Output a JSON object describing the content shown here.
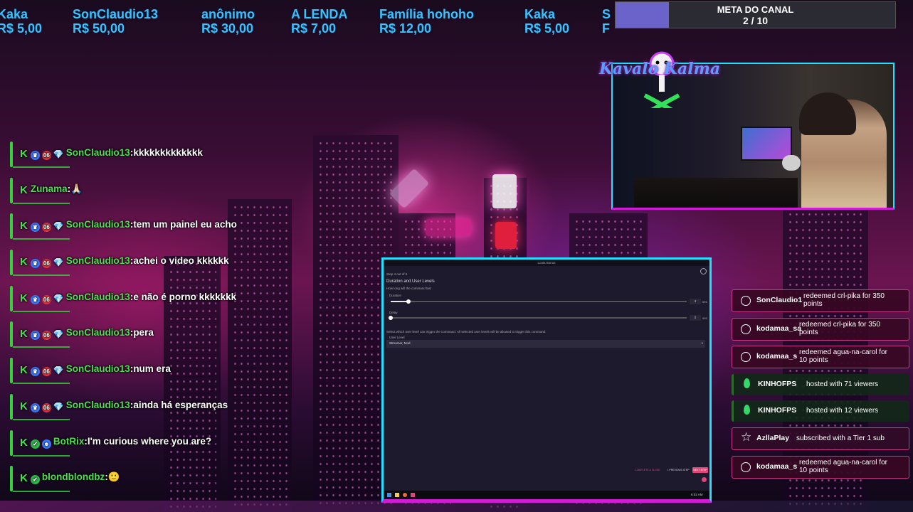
{
  "ticker": {
    "items": [
      {
        "name": "Kaka",
        "amount": "R$ 5,00"
      },
      {
        "name": "SonClaudio13",
        "amount": "R$ 50,00"
      },
      {
        "name": "anônimo",
        "amount": "R$ 30,00"
      },
      {
        "name": "A LENDA",
        "amount": "R$ 7,00"
      },
      {
        "name": "Família hohoho",
        "amount": "R$ 12,00"
      },
      {
        "name": "Kaka",
        "amount": "R$ 5,00"
      },
      {
        "name": "S",
        "amount": "F"
      }
    ]
  },
  "goal": {
    "title": "META DO CANAL",
    "value": "2 / 10",
    "progress": 0.19,
    "fill_color": "#6b63c9"
  },
  "channel_logo": {
    "text": "Kavalo Kalma"
  },
  "chat": {
    "messages": [
      {
        "badges": [
          "k",
          "crown",
          "06",
          "gem"
        ],
        "user": "SonClaudio13",
        "text": "kkkkkkkkkkkkk"
      },
      {
        "badges": [
          "k"
        ],
        "user": "Zunama",
        "text": "🙏🏻"
      },
      {
        "badges": [
          "k",
          "crown",
          "06",
          "gem"
        ],
        "user": "SonClaudio13",
        "text": "tem um painel eu acho"
      },
      {
        "badges": [
          "k",
          "crown",
          "06",
          "gem"
        ],
        "user": "SonClaudio13",
        "text": "achei o video kkkkkk"
      },
      {
        "badges": [
          "k",
          "crown",
          "06",
          "gem"
        ],
        "user": "SonClaudio13",
        "text": "e não é porno kkkkkkk"
      },
      {
        "badges": [
          "k",
          "crown",
          "06",
          "gem"
        ],
        "user": "SonClaudio13",
        "text": "pera"
      },
      {
        "badges": [
          "k",
          "crown",
          "06",
          "gem"
        ],
        "user": "SonClaudio13",
        "text": "num era"
      },
      {
        "badges": [
          "k",
          "crown",
          "06",
          "gem"
        ],
        "user": "SonClaudio13",
        "text": "ainda há esperanças"
      },
      {
        "badges": [
          "k",
          "check",
          "bot"
        ],
        "user": "BotRix",
        "text": "I'm curious where you are?"
      },
      {
        "badges": [
          "k",
          "check"
        ],
        "user": "blondblondbz",
        "text": "🙂"
      }
    ],
    "badge_labels": {
      "06": "06"
    }
  },
  "events": [
    {
      "type": "redeem",
      "user": "SonClaudio1",
      "text": "redeemed crl-pika for 350 points"
    },
    {
      "type": "redeem",
      "user": "kodamaa_sa",
      "text": "redeemed crl-pika for 350 points"
    },
    {
      "type": "redeem",
      "user": "kodamaa_s",
      "text": "redeemed agua-na-carol for 10 points"
    },
    {
      "type": "host",
      "user": "KINHOFPS",
      "text": "hosted with 71 viewers"
    },
    {
      "type": "host",
      "user": "KINHOFPS",
      "text": "hosted with 12 viewers"
    },
    {
      "type": "sub",
      "user": "AzllaPlay",
      "text": "subscribed with a Tier 1 sub"
    },
    {
      "type": "redeem",
      "user": "kodamaa_s",
      "text": "redeemed agua-na-carol for 10 points"
    }
  ],
  "settings_window": {
    "title": "Loots Bonus",
    "step": "Step 4 out of 5",
    "heading": "Duration and User Levels",
    "hint": "How long will the command last",
    "duration_label": "Duration",
    "duration_value": "4",
    "duration_unit": "sec",
    "duration_fraction": 0.06,
    "delay_label": "Delay",
    "delay_value": "0",
    "delay_unit": "sec",
    "delay_fraction": 0.0,
    "user_level_hint": "Select which user level can trigger the command. All selected user levels will be allowed to trigger this command",
    "user_level_label": "User Level",
    "user_level_value": "Streamer, Mod",
    "btn_complete": "COMPLETE & CLOSE",
    "btn_previous": "< PREVIOUS STEP",
    "btn_next": "NEXT STEP",
    "clock": "6:02 AM"
  }
}
